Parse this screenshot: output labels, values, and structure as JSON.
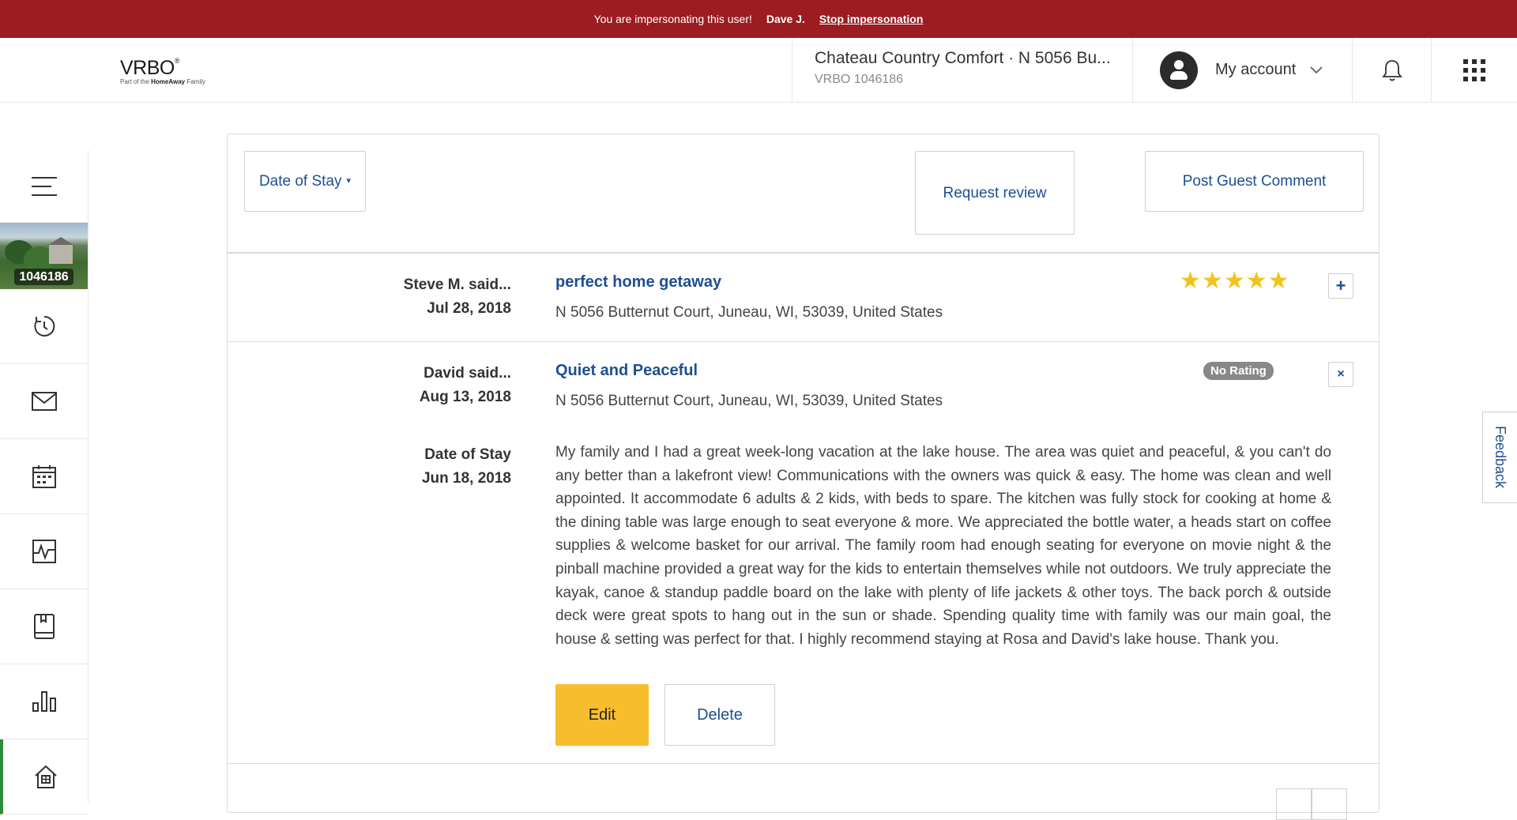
{
  "banner": {
    "message": "You are impersonating this user!",
    "user": "Dave J.",
    "stop_link": "Stop impersonation"
  },
  "header": {
    "logo_brand": "VRBO",
    "logo_sub_prefix": "Part of the ",
    "logo_sub_bold": "HomeAway",
    "logo_sub_suffix": " Family",
    "property_name": "Chateau Country Comfort · N 5056 Bu...",
    "property_id": "VRBO 1046186",
    "account_label": "My account"
  },
  "sidebar": {
    "thumbnail_label": "1046186"
  },
  "toolbar": {
    "date_filter": "Date of Stay",
    "request_review": "Request review",
    "post_comment": "Post Guest Comment"
  },
  "reviews": [
    {
      "reviewer": "Steve M. said...",
      "date": "Jul 28, 2018",
      "title": "perfect home getaway",
      "address": "N 5056 Butternut Court, Juneau, WI, 53039, United States",
      "rating": 5,
      "toggle": "+"
    },
    {
      "reviewer": "David said...",
      "date": "Aug 13, 2018",
      "title": "Quiet and Peaceful",
      "address": "N 5056 Butternut Court, Juneau, WI, 53039, United States",
      "rating_badge": "No Rating",
      "toggle": "×",
      "stay_label": "Date of Stay",
      "stay_date": "Jun 18, 2018",
      "body": "My family and I had a great week-long vacation at the lake house. The area was quiet and peaceful, & you can't do any better than a lakefront view! Communications with the owners was quick & easy. The home was clean and well appointed. It accommodate 6 adults & 2 kids, with beds to spare. The kitchen was fully stock for cooking at home & the dining table was large enough to seat everyone & more. We appreciated the bottle water, a heads start on coffee supplies & welcome basket for our arrival. The family room had enough seating for everyone on movie night & the pinball machine provided a great way for the kids to entertain themselves while not outdoors. We truly appreciate the kayak, canoe & standup paddle board on the lake with plenty of life jackets & other toys. The back porch & outside deck were great spots to hang out in the sun or shade. Spending quality time with family was our main goal, the house & setting was perfect for that. I highly recommend staying at Rosa and David's lake house. Thank you.",
      "edit_label": "Edit",
      "delete_label": "Delete"
    }
  ],
  "feedback_label": "Feedback",
  "colors": {
    "banner": "#9b1c21",
    "link_blue": "#1d4f91",
    "edit_yellow": "#f7bd2c",
    "star_gold": "#f3c21b",
    "active_green": "#2c8c3c"
  }
}
